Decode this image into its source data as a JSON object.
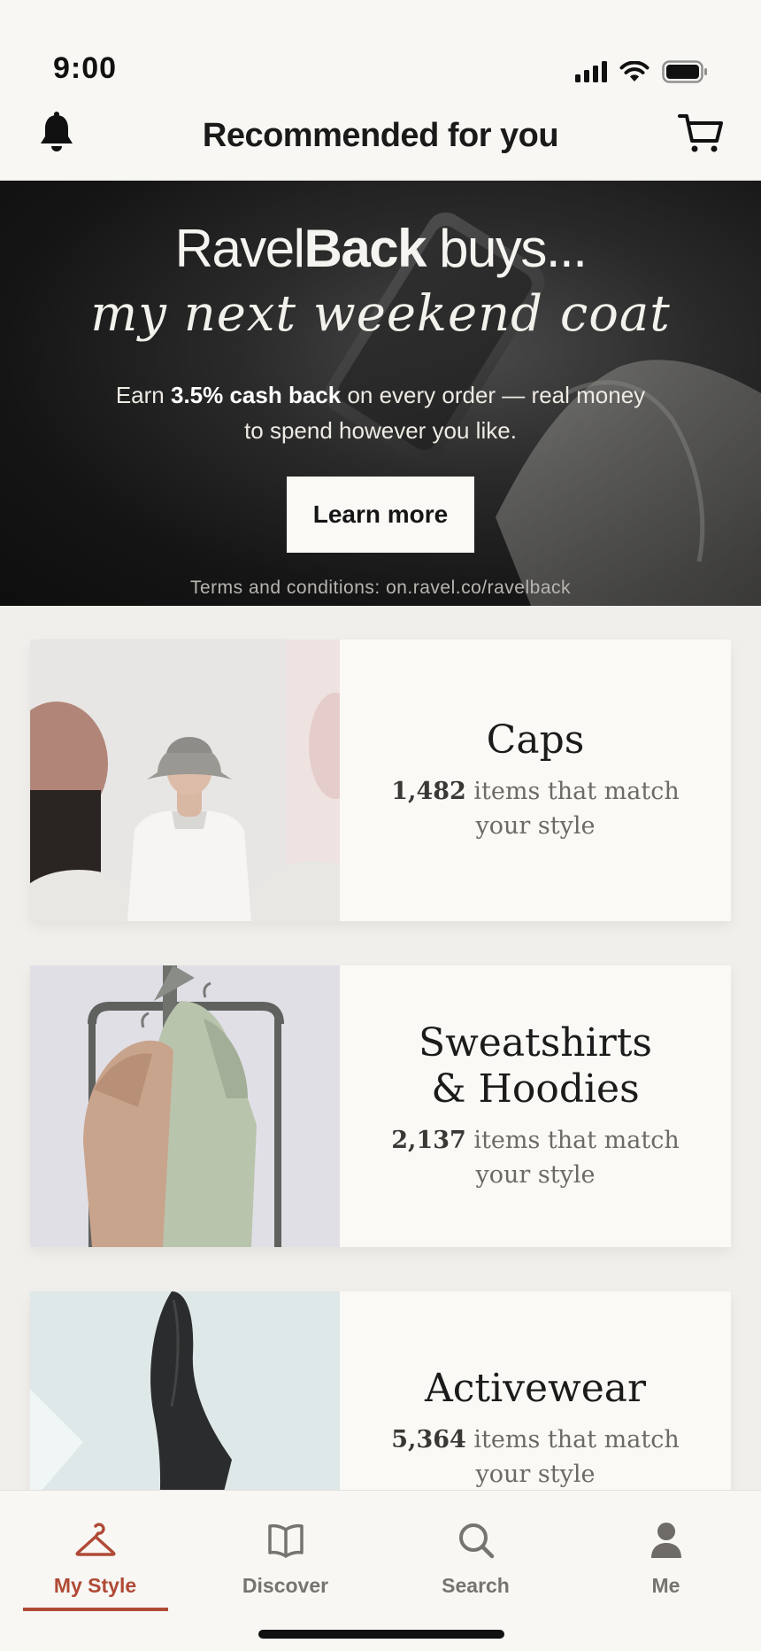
{
  "status_bar": {
    "time": "9:00"
  },
  "header": {
    "title": "Recommended for you"
  },
  "hero": {
    "brand_regular": "Ravel",
    "brand_bold": "Back",
    "brand_suffix": " buys...",
    "tagline": "my next weekend coat",
    "desc_prefix": "Earn ",
    "desc_bold": "3.5% cash back",
    "desc_suffix": " on every order — real money to spend however you like.",
    "button_label": "Learn more",
    "terms": "Terms and conditions: on.ravel.co/ravelback"
  },
  "categories": [
    {
      "title": "Caps",
      "count": "1,482",
      "suffix": " items that match your style"
    },
    {
      "title": "Sweatshirts & Hoodies",
      "count": "2,137",
      "suffix": " items that match your style"
    },
    {
      "title": "Activewear",
      "count": "5,364",
      "suffix": " items that match your style"
    }
  ],
  "nav": {
    "items": [
      {
        "label": "My Style",
        "icon": "hanger-icon",
        "active": true
      },
      {
        "label": "Discover",
        "icon": "book-icon",
        "active": false
      },
      {
        "label": "Search",
        "icon": "search-icon",
        "active": false
      },
      {
        "label": "Me",
        "icon": "person-icon",
        "active": false
      }
    ]
  },
  "colors": {
    "accent": "#b04a36",
    "background": "#f1efeb",
    "surface": "#faf9f6",
    "hero_dark": "#151515"
  }
}
